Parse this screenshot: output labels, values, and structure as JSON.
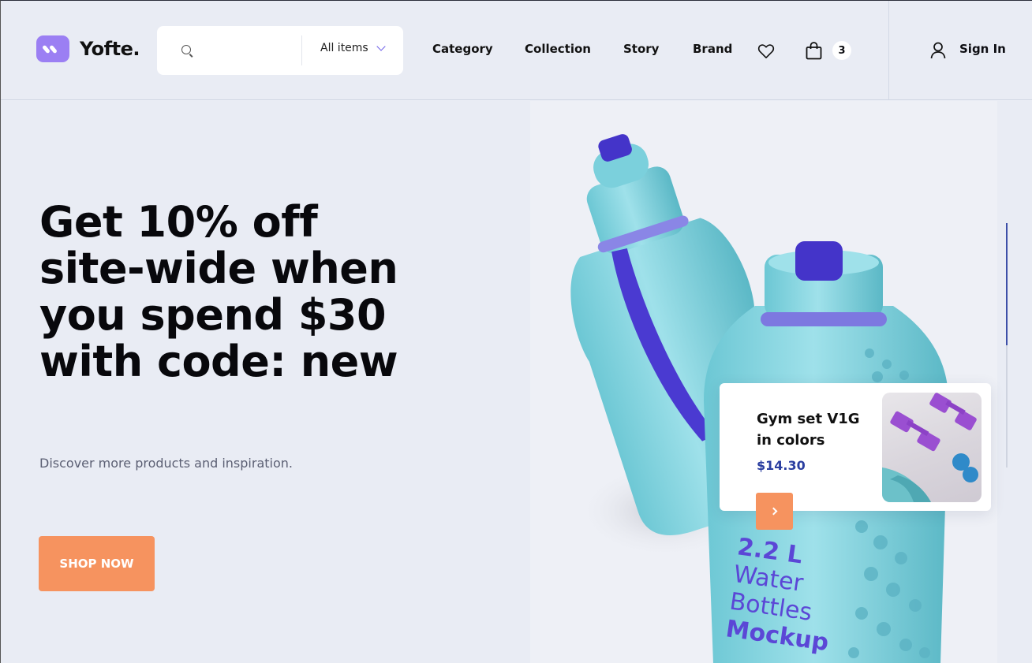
{
  "header": {
    "brand": "Yofte.",
    "search": {
      "value": "",
      "placeholder": "",
      "category": "All items"
    },
    "nav": [
      "Category",
      "Collection",
      "Story",
      "Brand"
    ],
    "cart_count": "3",
    "signin_label": "Sign In"
  },
  "hero": {
    "title": "Get 10% off site-wide when you spend $30 with code: new",
    "subtitle": "Discover more products and inspiration.",
    "cta_label": "SHOP NOW",
    "image_text": [
      "2.2 L",
      "Water",
      "Bottles",
      "Mockup"
    ]
  },
  "product_card": {
    "name": "Gym set V1G in colors",
    "price": "$14.30"
  },
  "colors": {
    "accent_orange": "#f6935f",
    "brand_purple": "#9b7ff3",
    "price_blue": "#2a3ea0",
    "background": "#e9ecf4"
  },
  "icons": [
    "search-icon",
    "chevron-down-icon",
    "heart-icon",
    "bag-icon",
    "user-icon",
    "arrow-right-icon"
  ]
}
